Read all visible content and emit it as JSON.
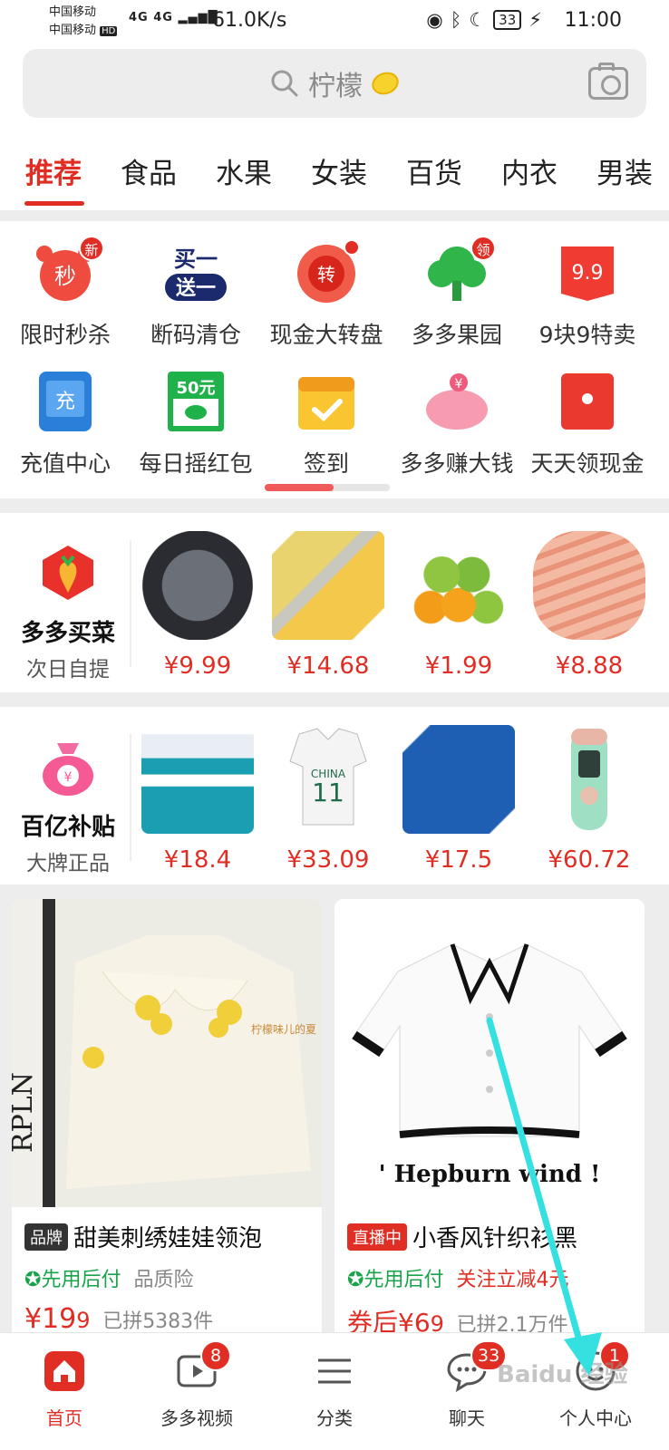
{
  "status_bar": {
    "carrier1": "中国移动",
    "carrier2": "中国移动",
    "hd": "HD",
    "signal": "4G 4G",
    "net_speed": "61.0K/s",
    "battery": "33",
    "time": "11:00"
  },
  "search": {
    "text": "柠檬"
  },
  "tabs": [
    "推荐",
    "食品",
    "水果",
    "女装",
    "百货",
    "内衣",
    "男装"
  ],
  "quick_row1": [
    {
      "label": "限时秒杀",
      "icon_text": "秒",
      "badge": "新"
    },
    {
      "label": "断码清仓",
      "icon_text": "买一送一"
    },
    {
      "label": "现金大转盘",
      "icon_text": "转"
    },
    {
      "label": "多多果园",
      "badge": "领"
    },
    {
      "label": "9块9特卖",
      "icon_text": "9.9"
    }
  ],
  "quick_row2": [
    {
      "label": "充值中心",
      "icon_text": "充"
    },
    {
      "label": "每日摇红包",
      "icon_text": "50元"
    },
    {
      "label": "签到"
    },
    {
      "label": "多多赚大钱",
      "icon_text": "¥"
    },
    {
      "label": "天天领现金"
    }
  ],
  "shelf1": {
    "title": "多多买菜",
    "subtitle": "次日自提",
    "prices": [
      "¥9.99",
      "¥14.68",
      "¥1.99",
      "¥8.88"
    ]
  },
  "shelf2": {
    "title": "百亿补贴",
    "subtitle": "大牌正品",
    "prices": [
      "¥18.4",
      "¥33.09",
      "¥17.5",
      "¥60.72"
    ]
  },
  "cards": [
    {
      "tag": "品牌",
      "title": "甜美刺绣娃娃领泡",
      "pay": "先用后付",
      "extra": "品质险",
      "price_prefix": "¥19",
      "price_small": "9",
      "sold": "已拼5383件"
    },
    {
      "tag": "直播中",
      "title": "小香风针织衫黑",
      "pay": "先用后付",
      "extra": "关注立减4元",
      "price_prefix": "券后¥6",
      "price_small": "9",
      "sold": "已拼2.1万件",
      "image_text": "' Hepburn wind !"
    }
  ],
  "nav": [
    {
      "label": "首页"
    },
    {
      "label": "多多视频",
      "badge": "8"
    },
    {
      "label": "分类"
    },
    {
      "label": "聊天",
      "badge": "33"
    },
    {
      "label": "个人中心",
      "badge": "1"
    }
  ],
  "watermark": "Baidu 经验"
}
